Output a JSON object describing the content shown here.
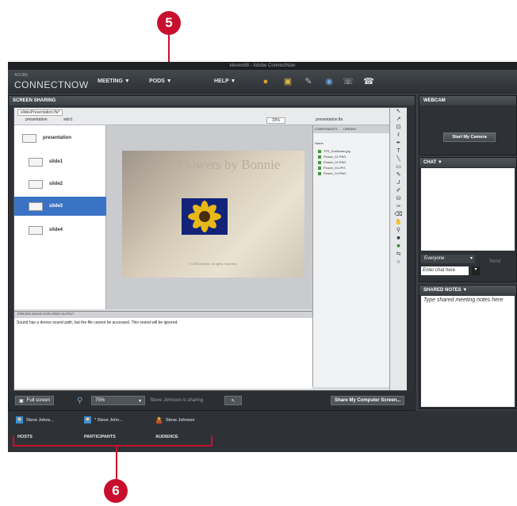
{
  "callouts": {
    "top": "5",
    "bottom": "6"
  },
  "window": {
    "title": "eleven88 - Adobe ConnectNow"
  },
  "brand": {
    "small": "ADOBE",
    "name": "CONNECTNOW"
  },
  "menus": [
    "MEETING ▼",
    "PODS ▼",
    "HELP ▼"
  ],
  "toolbar_icons": [
    "participants-icon",
    "screen-share-icon",
    "whiteboard-icon",
    "webcam-icon",
    "phone-icon",
    "telephone-icon"
  ],
  "screen_pod": {
    "title": "SCREEN SHARING",
    "doc_tab": "slidesPresentation.fla*",
    "subtabs": [
      "presentation",
      "skin1"
    ],
    "zoom_small": "33%",
    "scene_label": "presentation.fla",
    "slides": [
      {
        "label": "presentation",
        "selected": false
      },
      {
        "label": "slide1",
        "selected": false
      },
      {
        "label": "slide2",
        "selected": false
      },
      {
        "label": "slide3",
        "selected": true
      },
      {
        "label": "slide4",
        "selected": false
      }
    ],
    "slide_title": "Flowers by Bonnie",
    "slide_caption": "© 2006 Adobe. All rights reserved.",
    "library": {
      "tabs": [
        "COMPONENTS",
        "LIBRARY"
      ],
      "header": "presentation.fla",
      "col_name": "Name",
      "items": [
        "TFS_Sunflower.jpg",
        "Flower_01.PNG",
        "Flower_02.PNG",
        "Flower_03.JPG",
        "Flower_04.PNG"
      ]
    },
    "output": {
      "tabs": "ERRORS   MOVIE EXPLORER   OUTPUT",
      "text": "Sound has a device sound path, but the file cannot be accessed. This sound will be ignored."
    },
    "footer": {
      "fullscreen": "Full screen",
      "zoom": "75%",
      "status": "Steve Johnson is sharing",
      "share_button": "Share My Computer Screen..."
    }
  },
  "webcam": {
    "title": "WEBCAM",
    "button": "Start My Camera"
  },
  "chat": {
    "title": "CHAT ▼",
    "to": "Everyone",
    "send": "Send",
    "input_placeholder": "Enter chat here"
  },
  "notes": {
    "title": "SHARED NOTES ▼",
    "placeholder": "Type shared meeting notes here"
  },
  "attendees": {
    "people": [
      {
        "name": "Steve Johns..."
      },
      {
        "name": "* Steve John..."
      },
      {
        "name": "Steve Johnson"
      }
    ],
    "groups": [
      "HOSTS",
      "PARTICIPANTS",
      "AUDIENCE"
    ]
  },
  "colors": {
    "callout": "#c8102e",
    "selection": "#3b73c4",
    "pod_bg": "#2e3236"
  }
}
